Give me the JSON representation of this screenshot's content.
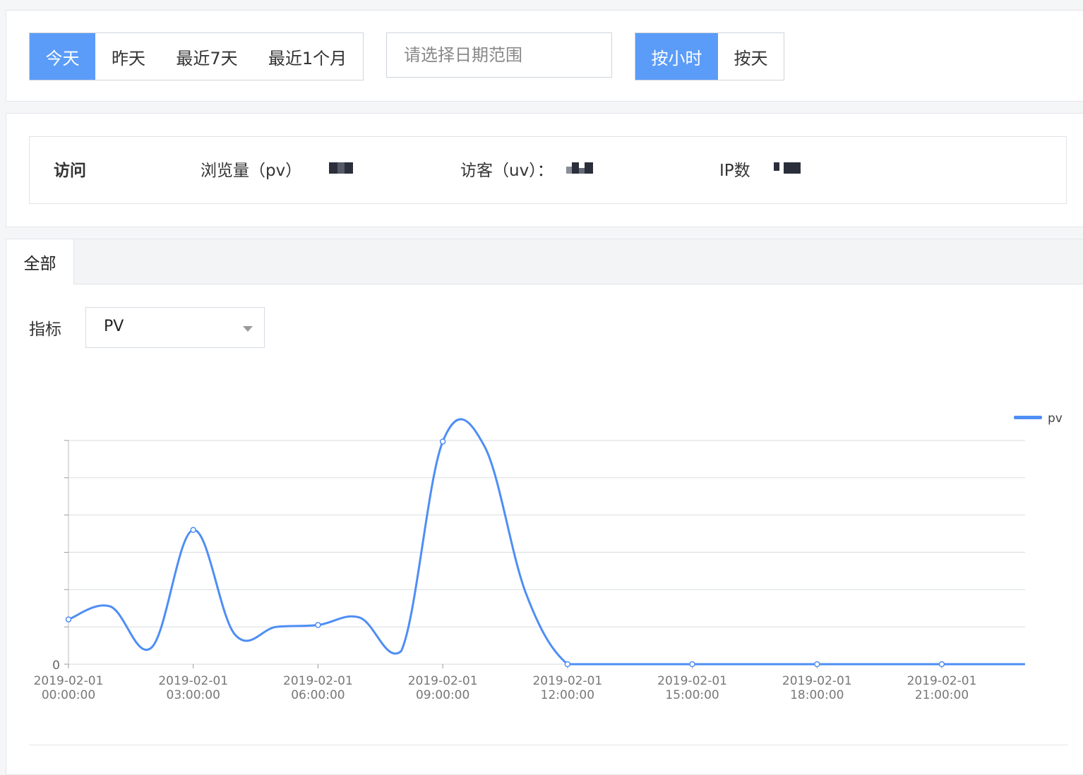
{
  "filters": {
    "range_buttons": [
      "今天",
      "昨天",
      "最近7天",
      "最近1个月"
    ],
    "range_active": 0,
    "date_placeholder": "请选择日期范围",
    "granularity_buttons": [
      "按小时",
      "按天"
    ],
    "granularity_active": 0
  },
  "summary": {
    "title": "访问",
    "pv_label": "浏览量（pv）",
    "uv_label": "访客（uv）：",
    "ip_label": "IP数"
  },
  "tabs": [
    "全部"
  ],
  "metric": {
    "label": "指标",
    "selected": "PV"
  },
  "colors": {
    "accent": "#5b9cf8",
    "line": "#4e8ef5",
    "grid": "#dde0e5"
  },
  "chart_data": {
    "type": "line",
    "legend": "pv",
    "legend_position": "top-right",
    "grid": true,
    "y_tick_labels": [
      "0"
    ],
    "ylim": [
      0,
      6
    ],
    "x_labels": [
      "2019-02-01\n00:00:00",
      "2019-02-01\n03:00:00",
      "2019-02-01\n06:00:00",
      "2019-02-01\n09:00:00",
      "2019-02-01\n12:00:00",
      "2019-02-01\n15:00:00",
      "2019-02-01\n18:00:00",
      "2019-02-01\n21:00:00"
    ],
    "series": [
      {
        "name": "pv",
        "x": [
          "00:00",
          "01:00",
          "02:00",
          "03:00",
          "04:00",
          "05:00",
          "06:00",
          "07:00",
          "08:00",
          "09:00",
          "10:00",
          "11:00",
          "12:00",
          "13:00",
          "14:00",
          "15:00",
          "16:00",
          "17:00",
          "18:00",
          "19:00",
          "20:00",
          "21:00",
          "22:00",
          "23:00"
        ],
        "values": [
          1.2,
          1.55,
          0.45,
          3.6,
          0.8,
          1.0,
          1.05,
          1.25,
          0.35,
          5.97,
          5.85,
          1.9,
          0,
          0,
          0,
          0,
          0,
          0,
          0,
          0,
          0,
          0,
          0,
          0
        ],
        "marked_points": [
          0,
          3,
          6,
          9,
          12,
          15,
          18,
          21
        ]
      }
    ]
  }
}
